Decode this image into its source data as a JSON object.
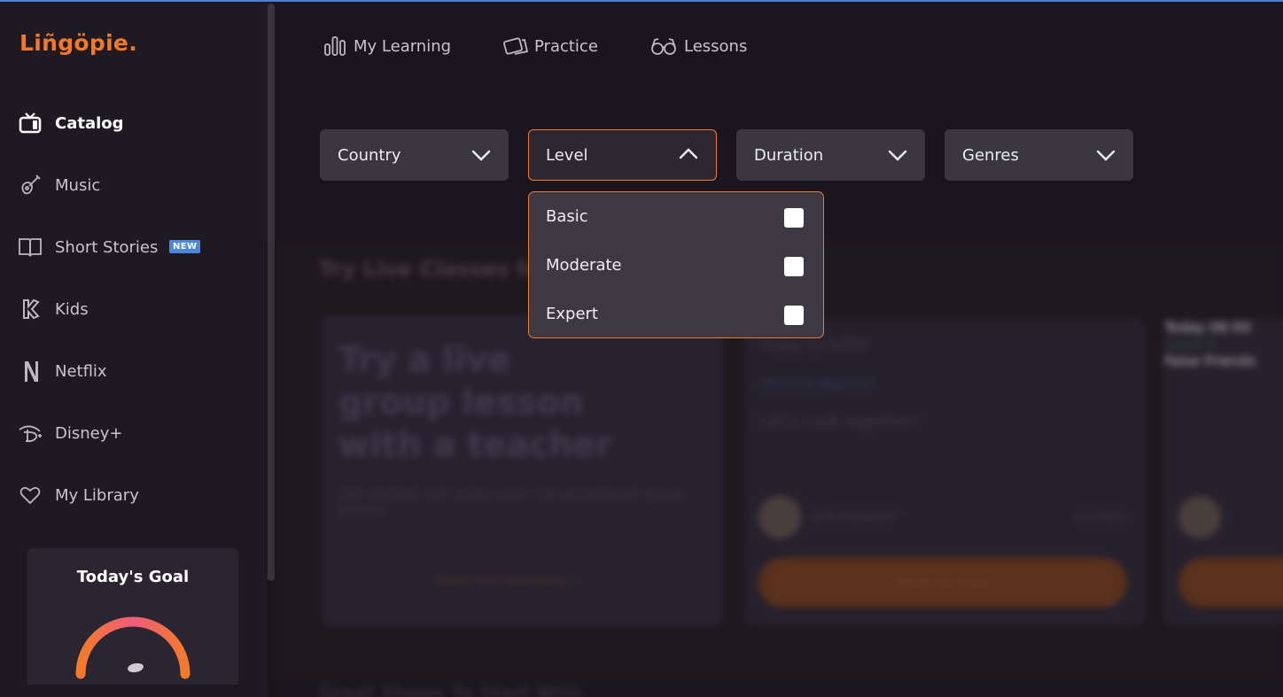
{
  "app": {
    "logo_text": "Liñgöpie.",
    "accent_color": "#f07a2a"
  },
  "sidebar": {
    "items": [
      {
        "label": "Catalog",
        "icon": "tv-icon",
        "active": true
      },
      {
        "label": "Music",
        "icon": "guitar-icon"
      },
      {
        "label": "Short Stories",
        "icon": "book-icon",
        "badge": "NEW"
      },
      {
        "label": "Kids",
        "icon": "kids-k-icon"
      },
      {
        "label": "Netflix",
        "icon": "netflix-n-icon"
      },
      {
        "label": "Disney+",
        "icon": "disney-icon"
      },
      {
        "label": "My Library",
        "icon": "heart-icon"
      }
    ],
    "goal": {
      "title": "Today's Goal",
      "progress": 0.05
    }
  },
  "topnav": {
    "items": [
      {
        "label": "My Learning",
        "icon": "bar-chart-icon"
      },
      {
        "label": "Practice",
        "icon": "cards-icon"
      },
      {
        "label": "Lessons",
        "icon": "glasses-icon"
      }
    ]
  },
  "filters": [
    {
      "label": "Country",
      "open": false
    },
    {
      "label": "Level",
      "open": true
    },
    {
      "label": "Duration",
      "open": false
    },
    {
      "label": "Genres",
      "open": false
    }
  ],
  "level_dropdown": {
    "options": [
      {
        "label": "Basic",
        "checked": false
      },
      {
        "label": "Moderate",
        "checked": false
      },
      {
        "label": "Expert",
        "checked": false
      }
    ]
  },
  "background": {
    "section_title": "Try Live Classes for",
    "promo_title": "Try a live group lesson with a teacher",
    "promo_subtitle": "Get started and enjoy your conversational group lesson.",
    "promo_link": "Meet our teachers →",
    "class_time": "Today 12:00PM",
    "class_level": "Absolute Beginner",
    "class_title": "Let's cook together!",
    "class_teacher": "with Elisabeth",
    "class_seats": "+2 more",
    "class_button": "Book for Free",
    "class2_time": "Today 06:00",
    "class2_level": "Level 2",
    "class2_title": "False Friends",
    "bottom_title": "Great Shows To Start With"
  }
}
